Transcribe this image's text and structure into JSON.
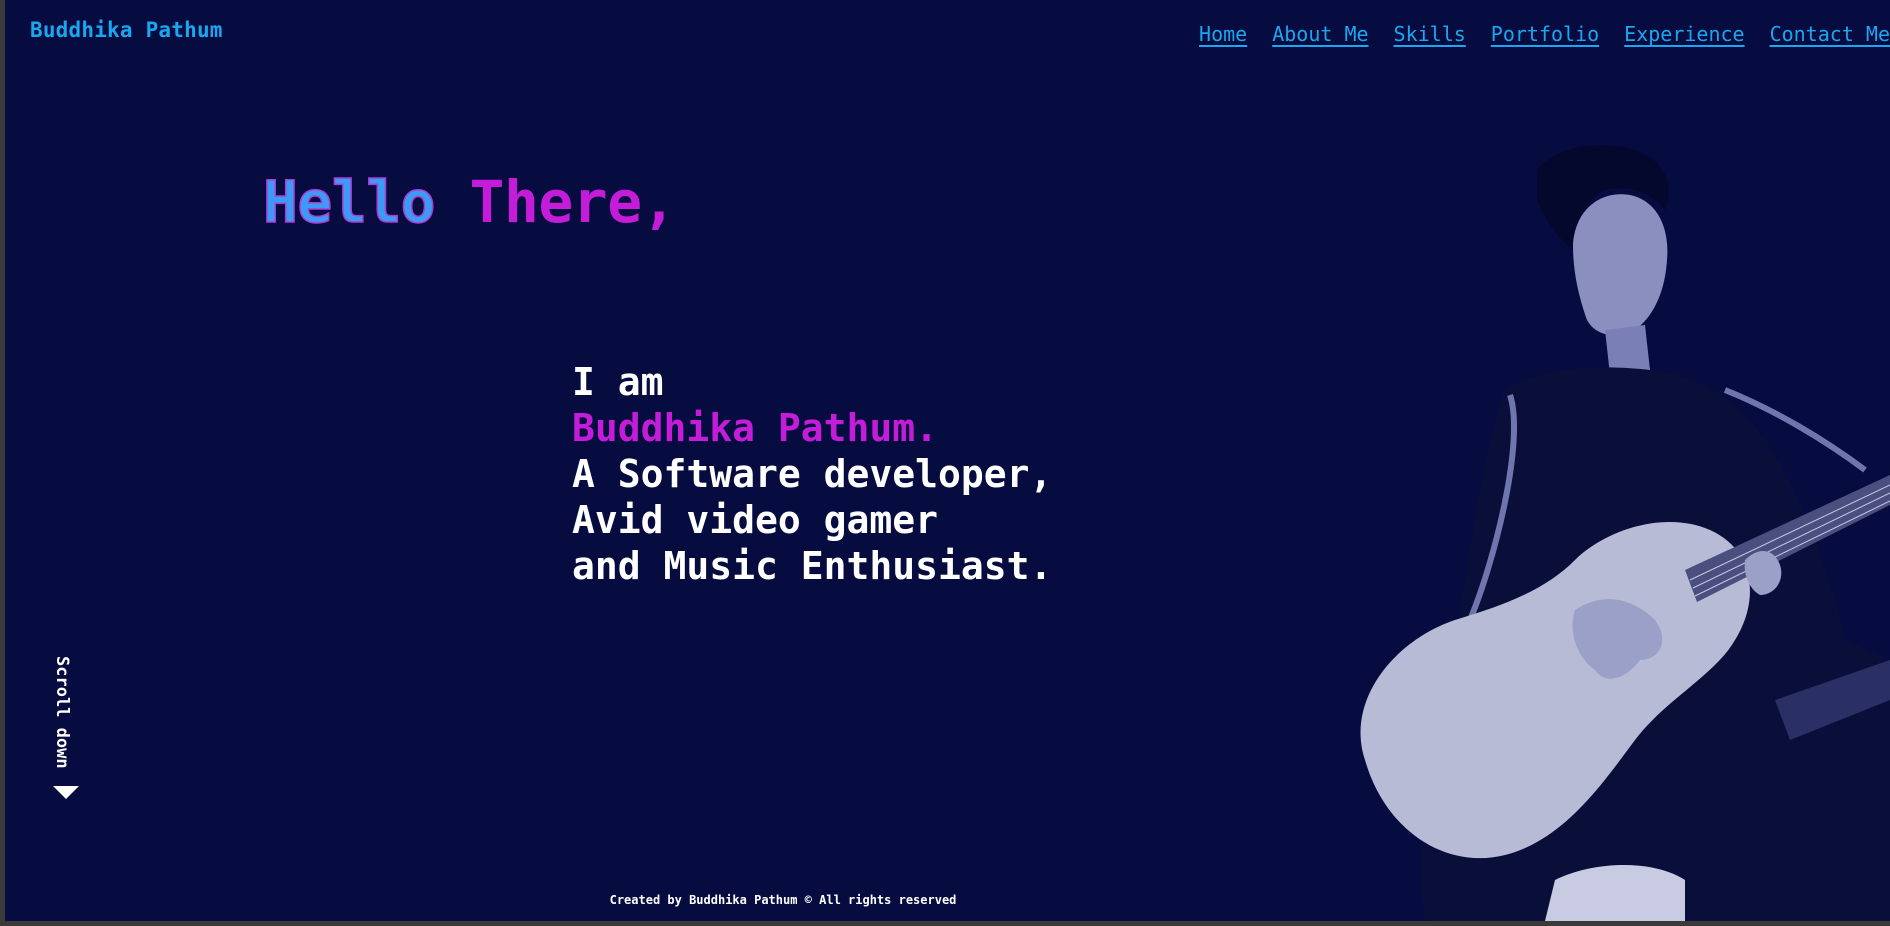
{
  "header": {
    "brand": "Buddhika Pathum",
    "nav": [
      "Home",
      "About Me",
      "Skills",
      "Portfolio",
      "Experience",
      "Contact Me"
    ]
  },
  "hero": {
    "greeting_part1": "Hello",
    "greeting_part2": "There,",
    "line1": "I am",
    "name": "Buddhika Pathum.",
    "line3": "A Software developer,",
    "line4": "Avid video gamer",
    "line5": "and Music Enthusiast."
  },
  "scroll": {
    "label": "Scroll down",
    "icon": "triangle-down-icon"
  },
  "footer": {
    "text": "Created by Buddhika Pathum © All rights reserved"
  },
  "colors": {
    "background": "#060c40",
    "accent_blue": "#19a7f0",
    "accent_magenta": "#c51cd9",
    "text": "#ffffff"
  }
}
